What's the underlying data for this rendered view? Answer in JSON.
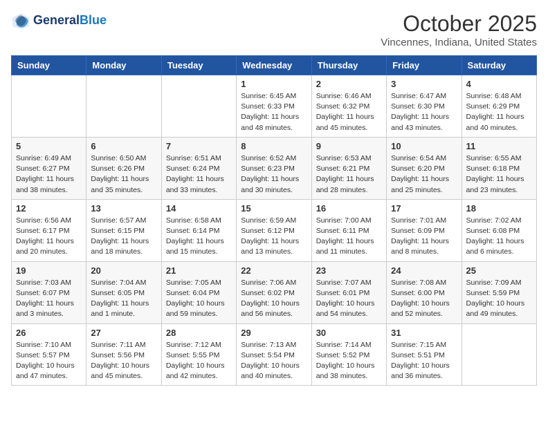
{
  "header": {
    "logo_line1": "General",
    "logo_line2": "Blue",
    "title": "October 2025",
    "subtitle": "Vincennes, Indiana, United States"
  },
  "weekdays": [
    "Sunday",
    "Monday",
    "Tuesday",
    "Wednesday",
    "Thursday",
    "Friday",
    "Saturday"
  ],
  "weeks": [
    [
      {
        "day": "",
        "info": ""
      },
      {
        "day": "",
        "info": ""
      },
      {
        "day": "",
        "info": ""
      },
      {
        "day": "1",
        "info": "Sunrise: 6:45 AM\nSunset: 6:33 PM\nDaylight: 11 hours\nand 48 minutes."
      },
      {
        "day": "2",
        "info": "Sunrise: 6:46 AM\nSunset: 6:32 PM\nDaylight: 11 hours\nand 45 minutes."
      },
      {
        "day": "3",
        "info": "Sunrise: 6:47 AM\nSunset: 6:30 PM\nDaylight: 11 hours\nand 43 minutes."
      },
      {
        "day": "4",
        "info": "Sunrise: 6:48 AM\nSunset: 6:29 PM\nDaylight: 11 hours\nand 40 minutes."
      }
    ],
    [
      {
        "day": "5",
        "info": "Sunrise: 6:49 AM\nSunset: 6:27 PM\nDaylight: 11 hours\nand 38 minutes."
      },
      {
        "day": "6",
        "info": "Sunrise: 6:50 AM\nSunset: 6:26 PM\nDaylight: 11 hours\nand 35 minutes."
      },
      {
        "day": "7",
        "info": "Sunrise: 6:51 AM\nSunset: 6:24 PM\nDaylight: 11 hours\nand 33 minutes."
      },
      {
        "day": "8",
        "info": "Sunrise: 6:52 AM\nSunset: 6:23 PM\nDaylight: 11 hours\nand 30 minutes."
      },
      {
        "day": "9",
        "info": "Sunrise: 6:53 AM\nSunset: 6:21 PM\nDaylight: 11 hours\nand 28 minutes."
      },
      {
        "day": "10",
        "info": "Sunrise: 6:54 AM\nSunset: 6:20 PM\nDaylight: 11 hours\nand 25 minutes."
      },
      {
        "day": "11",
        "info": "Sunrise: 6:55 AM\nSunset: 6:18 PM\nDaylight: 11 hours\nand 23 minutes."
      }
    ],
    [
      {
        "day": "12",
        "info": "Sunrise: 6:56 AM\nSunset: 6:17 PM\nDaylight: 11 hours\nand 20 minutes."
      },
      {
        "day": "13",
        "info": "Sunrise: 6:57 AM\nSunset: 6:15 PM\nDaylight: 11 hours\nand 18 minutes."
      },
      {
        "day": "14",
        "info": "Sunrise: 6:58 AM\nSunset: 6:14 PM\nDaylight: 11 hours\nand 15 minutes."
      },
      {
        "day": "15",
        "info": "Sunrise: 6:59 AM\nSunset: 6:12 PM\nDaylight: 11 hours\nand 13 minutes."
      },
      {
        "day": "16",
        "info": "Sunrise: 7:00 AM\nSunset: 6:11 PM\nDaylight: 11 hours\nand 11 minutes."
      },
      {
        "day": "17",
        "info": "Sunrise: 7:01 AM\nSunset: 6:09 PM\nDaylight: 11 hours\nand 8 minutes."
      },
      {
        "day": "18",
        "info": "Sunrise: 7:02 AM\nSunset: 6:08 PM\nDaylight: 11 hours\nand 6 minutes."
      }
    ],
    [
      {
        "day": "19",
        "info": "Sunrise: 7:03 AM\nSunset: 6:07 PM\nDaylight: 11 hours\nand 3 minutes."
      },
      {
        "day": "20",
        "info": "Sunrise: 7:04 AM\nSunset: 6:05 PM\nDaylight: 11 hours\nand 1 minute."
      },
      {
        "day": "21",
        "info": "Sunrise: 7:05 AM\nSunset: 6:04 PM\nDaylight: 10 hours\nand 59 minutes."
      },
      {
        "day": "22",
        "info": "Sunrise: 7:06 AM\nSunset: 6:02 PM\nDaylight: 10 hours\nand 56 minutes."
      },
      {
        "day": "23",
        "info": "Sunrise: 7:07 AM\nSunset: 6:01 PM\nDaylight: 10 hours\nand 54 minutes."
      },
      {
        "day": "24",
        "info": "Sunrise: 7:08 AM\nSunset: 6:00 PM\nDaylight: 10 hours\nand 52 minutes."
      },
      {
        "day": "25",
        "info": "Sunrise: 7:09 AM\nSunset: 5:59 PM\nDaylight: 10 hours\nand 49 minutes."
      }
    ],
    [
      {
        "day": "26",
        "info": "Sunrise: 7:10 AM\nSunset: 5:57 PM\nDaylight: 10 hours\nand 47 minutes."
      },
      {
        "day": "27",
        "info": "Sunrise: 7:11 AM\nSunset: 5:56 PM\nDaylight: 10 hours\nand 45 minutes."
      },
      {
        "day": "28",
        "info": "Sunrise: 7:12 AM\nSunset: 5:55 PM\nDaylight: 10 hours\nand 42 minutes."
      },
      {
        "day": "29",
        "info": "Sunrise: 7:13 AM\nSunset: 5:54 PM\nDaylight: 10 hours\nand 40 minutes."
      },
      {
        "day": "30",
        "info": "Sunrise: 7:14 AM\nSunset: 5:52 PM\nDaylight: 10 hours\nand 38 minutes."
      },
      {
        "day": "31",
        "info": "Sunrise: 7:15 AM\nSunset: 5:51 PM\nDaylight: 10 hours\nand 36 minutes."
      },
      {
        "day": "",
        "info": ""
      }
    ]
  ]
}
